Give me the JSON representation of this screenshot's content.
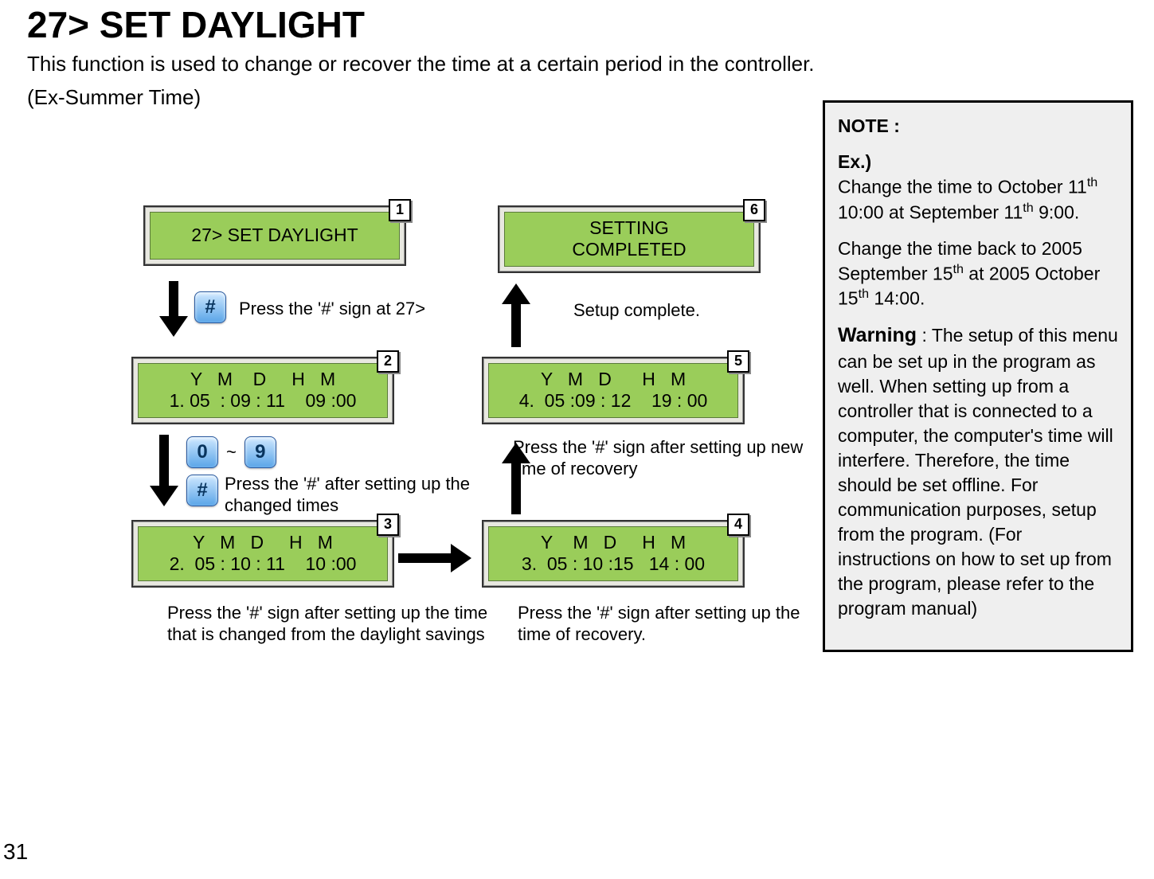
{
  "title": "27> SET DAYLIGHT",
  "subtitle_line1": "This function is used to change or recover the time at a certain period in the controller.",
  "subtitle_line2": "(Ex-Summer Time)",
  "page_number": "31",
  "steps": {
    "s1": {
      "num": "1",
      "line1": "27> SET DAYLIGHT"
    },
    "s2": {
      "num": "2",
      "line1": "Y   M    D     H   M",
      "line2": "1. 05  : 09 : 11    09 :00"
    },
    "s3": {
      "num": "3",
      "line1": "Y   M   D     H   M",
      "line2": "2.  05 : 10 : 11    10 :00"
    },
    "s4": {
      "num": "4",
      "line1": "Y    M   D     H   M",
      "line2": "3.  05 : 10 :15   14 : 00"
    },
    "s5": {
      "num": "5",
      "line1": "Y   M   D      H   M",
      "line2": "4.  05 :09 : 12    19 : 00"
    },
    "s6": {
      "num": "6",
      "line1": "SETTING",
      "line2": "COMPLETED"
    }
  },
  "captions": {
    "c1": "Press the '#' sign at 27>",
    "c2": "Press the '#' after setting up the changed times",
    "c3": "Press the '#' sign after setting up the time that is changed from the daylight savings",
    "c4": "Press the '#' sign after setting up the time of recovery.",
    "c5": "Press the '#' sign after setting up new time of recovery",
    "c6": "Setup complete."
  },
  "keys": {
    "hash": "#",
    "zero": "0",
    "nine": "9",
    "tilde": "~"
  },
  "note": {
    "heading": "NOTE :",
    "ex_label": "Ex.)",
    "ex_p1_a": " Change the time to October 11",
    "ex_p1_b": " 10:00 at September 11",
    "ex_p1_c": " 9:00.",
    "ex_p2_a": " Change the time back to 2005 September 15",
    "ex_p2_b": " at 2005 October 15",
    "ex_p2_c": " 14:00.",
    "warn_label": "Warning",
    "warn_body": " :  The setup of this menu can be set up in the program as well. When setting up from a controller that is connected to a computer, the computer's time will interfere. Therefore, the time should be set offline. For communication purposes, setup from the program. (For instructions on how to set up from the program, please refer to the program manual)",
    "th": "th"
  }
}
